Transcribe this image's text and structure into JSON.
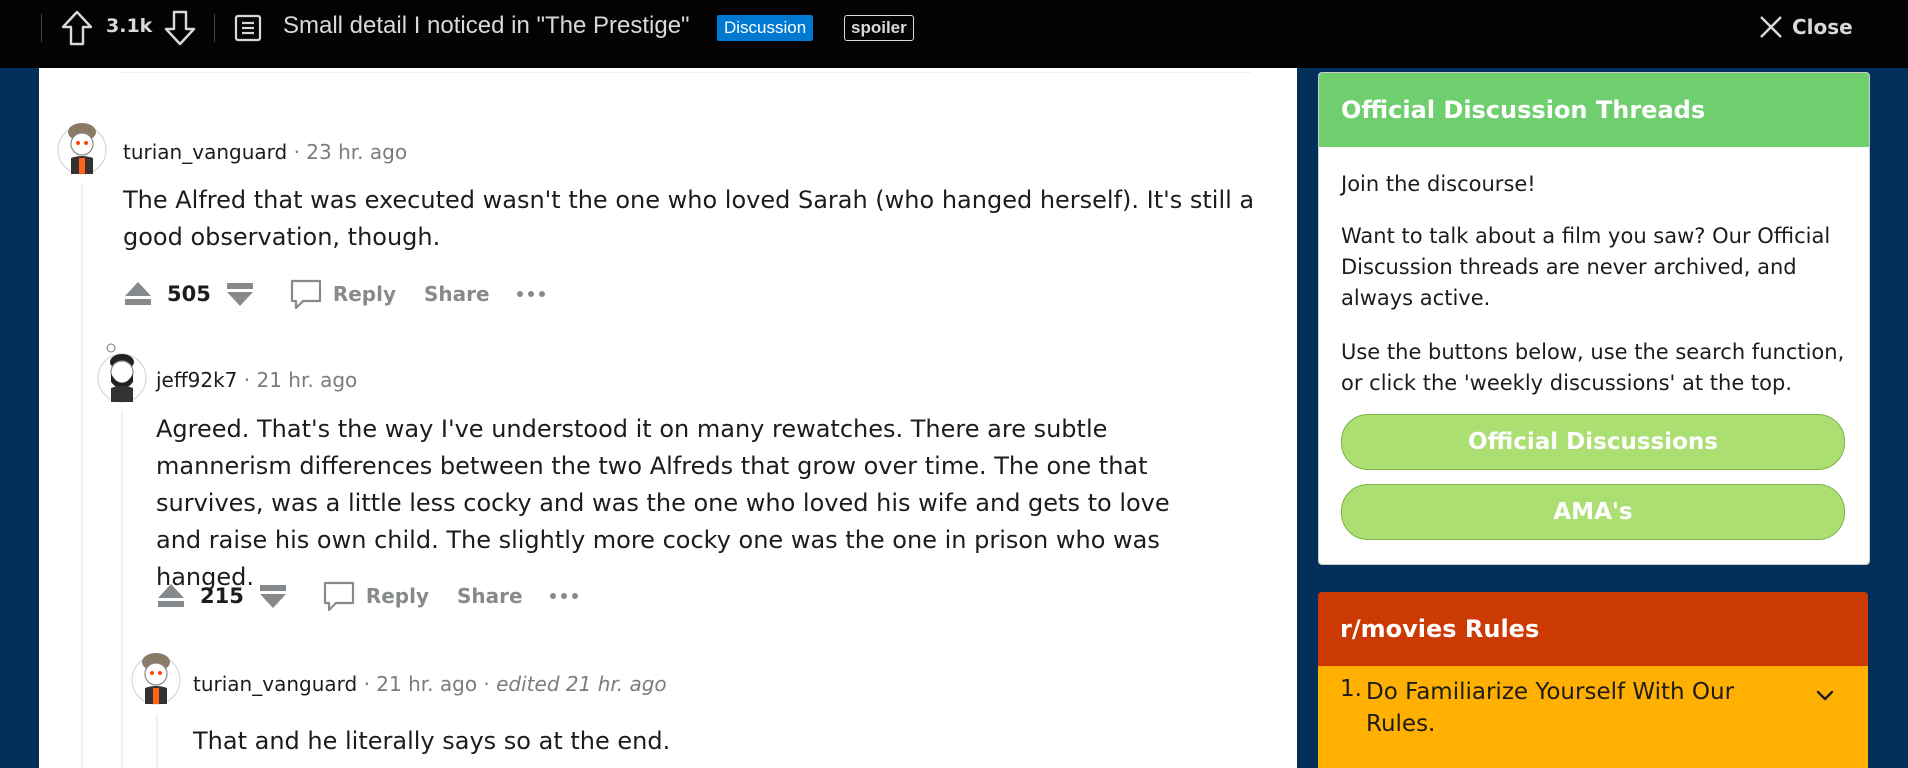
{
  "topbar": {
    "score": "3.1k",
    "title": "Small detail I noticed in \"The Prestige\"",
    "flair": "Discussion",
    "spoiler": "spoiler",
    "close_label": "Close"
  },
  "comments": [
    {
      "user": "turian_vanguard",
      "meta": "· 23 hr. ago",
      "body": "The Alfred that was executed wasn't the one who loved Sarah (who hanged herself). It's still a good observation, though.",
      "score": "505",
      "reply": "Reply",
      "share": "Share"
    },
    {
      "user": "jeff92k7",
      "meta": "· 21 hr. ago",
      "body": "Agreed. That's the way I've understood it on many rewatches. There are subtle mannerism differences between the two Alfreds that grow over time. The one that survives, was a little less cocky and was the one who loved his wife and gets to love and raise his own child. The slightly more cocky one was the one in prison who was hanged.",
      "score": "215",
      "reply": "Reply",
      "share": "Share"
    },
    {
      "user": "turian_vanguard",
      "meta": "· 21 hr. ago ·",
      "edited": "edited 21 hr. ago",
      "body": "That and he literally says so at the end."
    }
  ],
  "sidebar": {
    "card1": {
      "title": "Official Discussion Threads",
      "p1": "Join the discourse!",
      "p2": "Want to talk about a film you saw? Our Official Discussion threads are never archived, and always active.",
      "p3": "Use the buttons below, use the search function, or click the 'weekly discussions' at the top.",
      "btn1": "Official Discussions",
      "btn2": "AMA's"
    },
    "card2": {
      "title": "r/movies Rules",
      "rule_number": "1.",
      "rule_text": "Do Familiarize Yourself With Our Rules."
    }
  },
  "colors": {
    "background": "#03305a",
    "topbar": "#030303",
    "flair": "#0079d3",
    "card1_header": "#6fcf6e",
    "pill": "#abdf72",
    "rules_header": "#cc3a04",
    "rules_body": "#ffb000"
  }
}
